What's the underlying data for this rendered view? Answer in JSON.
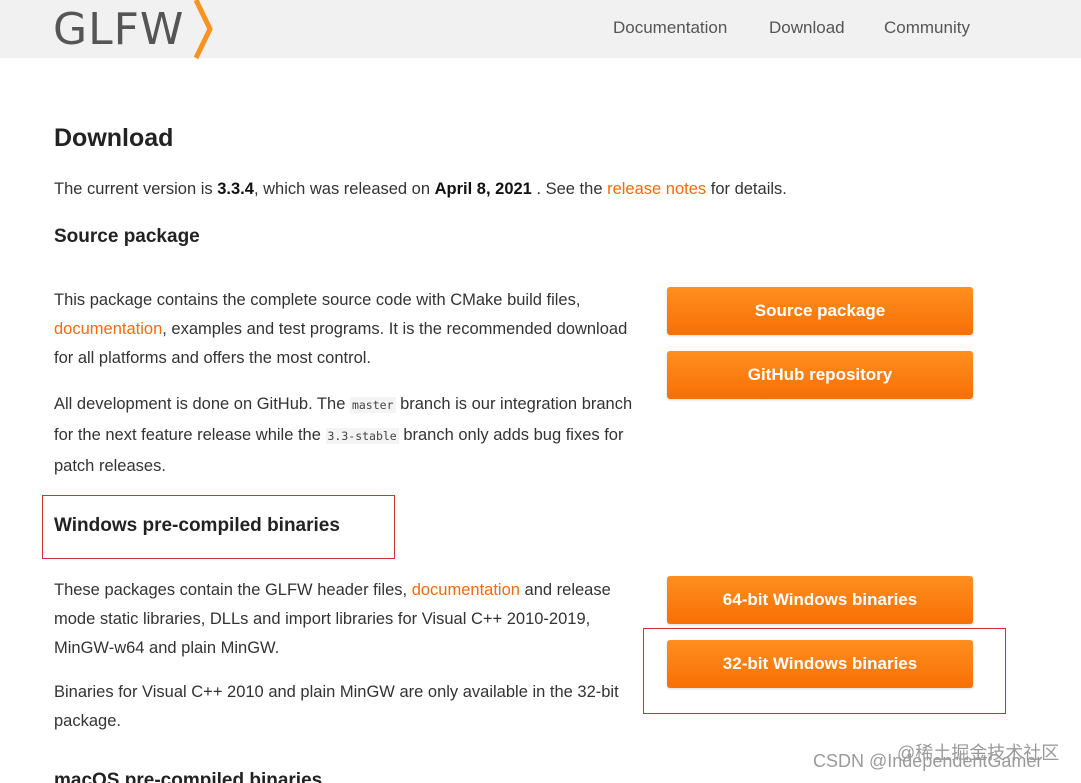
{
  "header": {
    "logo": "GLFW",
    "nav": [
      "Documentation",
      "Download",
      "Community"
    ]
  },
  "page": {
    "title": "Download",
    "intro": {
      "prefix": "The current version is ",
      "version": "3.3.4",
      "middle": ", which was released on ",
      "date": "April 8, 2021",
      "after_date": " . See the ",
      "link": "release notes",
      "suffix": " for details."
    }
  },
  "source_section": {
    "heading": "Source package",
    "p1": {
      "before": "This package contains the complete source code with CMake build files, ",
      "link": "documentation",
      "after": ", examples and test programs. It is the recommended download for all platforms and offers the most control."
    },
    "p2": {
      "before": "All development is done on GitHub. The ",
      "code1": "master",
      "middle": " branch is our integration branch for the next feature release while the ",
      "code2": "3.3-stable",
      "after": " branch only adds bug fixes for patch releases."
    },
    "buttons": [
      "Source package",
      "GitHub repository"
    ]
  },
  "windows_section": {
    "heading": "Windows pre-compiled binaries",
    "p1": {
      "before": "These packages contain the GLFW header files, ",
      "link": "documentation",
      "after": " and release mode static libraries, DLLs and import libraries for Visual C++ 2010-2019, MinGW-w64 and plain MinGW."
    },
    "p2": "Binaries for Visual C++ 2010 and plain MinGW are only available in the 32-bit package.",
    "buttons": [
      "64-bit Windows binaries",
      "32-bit Windows binaries"
    ]
  },
  "macos_section": {
    "heading": "macOS pre-compiled binaries"
  },
  "watermarks": [
    "@稀土掘金技术社区",
    "CSDN @IndependentGamer"
  ],
  "colors": {
    "accent": "#f26b0d",
    "button": "#f97a0e",
    "highlight": "#d32f3a",
    "header_bg": "#f1f1f1"
  }
}
